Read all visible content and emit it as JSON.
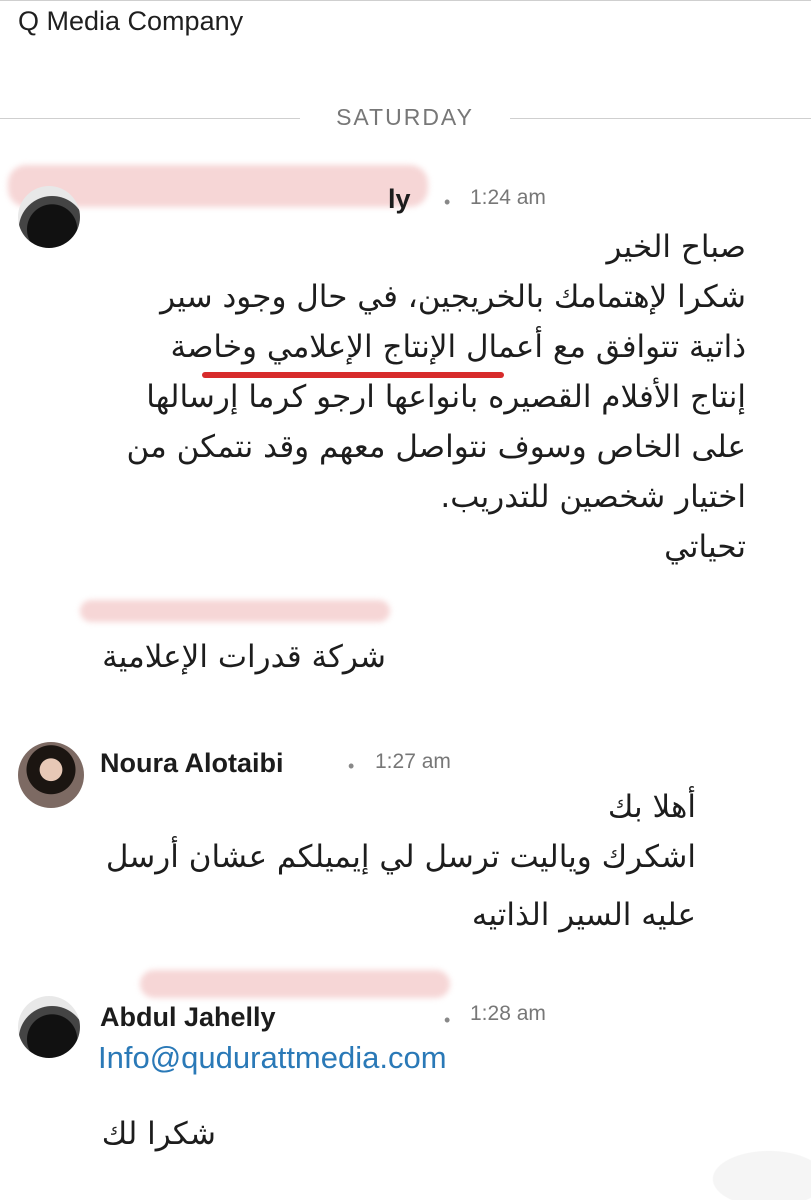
{
  "header": {
    "title": "Q Media Company"
  },
  "day_separator": {
    "label": "SATURDAY"
  },
  "messages": [
    {
      "sender": "ly",
      "time": "1:24 am",
      "lines": [
        "صباح الخير",
        "شكرا لإهتمامك بالخريجين، في حال وجود سير",
        "ذاتية تتوافق مع أعمال الإنتاج الإعلامي وخاصة",
        "إنتاج الأفلام القصيره بانواعها ارجو كرما إرسالها",
        "على الخاص وسوف نتواصل معهم وقد نتمكن من",
        "اختيار شخصين للتدريب.",
        "تحياتي"
      ],
      "signature": "شركة قدرات الإعلامية"
    },
    {
      "sender": "Noura Alotaibi",
      "time": "1:27 am",
      "lines": [
        "أهلا بك",
        "اشكرك وياليت ترسل لي إيميلكم عشان أرسل",
        "عليه السير الذاتيه"
      ]
    },
    {
      "sender": "Abdul Jahelly",
      "time": "1:28 am",
      "email": "Info@qudurattmedia.com",
      "lines": [
        "شكرا لك"
      ]
    }
  ]
}
